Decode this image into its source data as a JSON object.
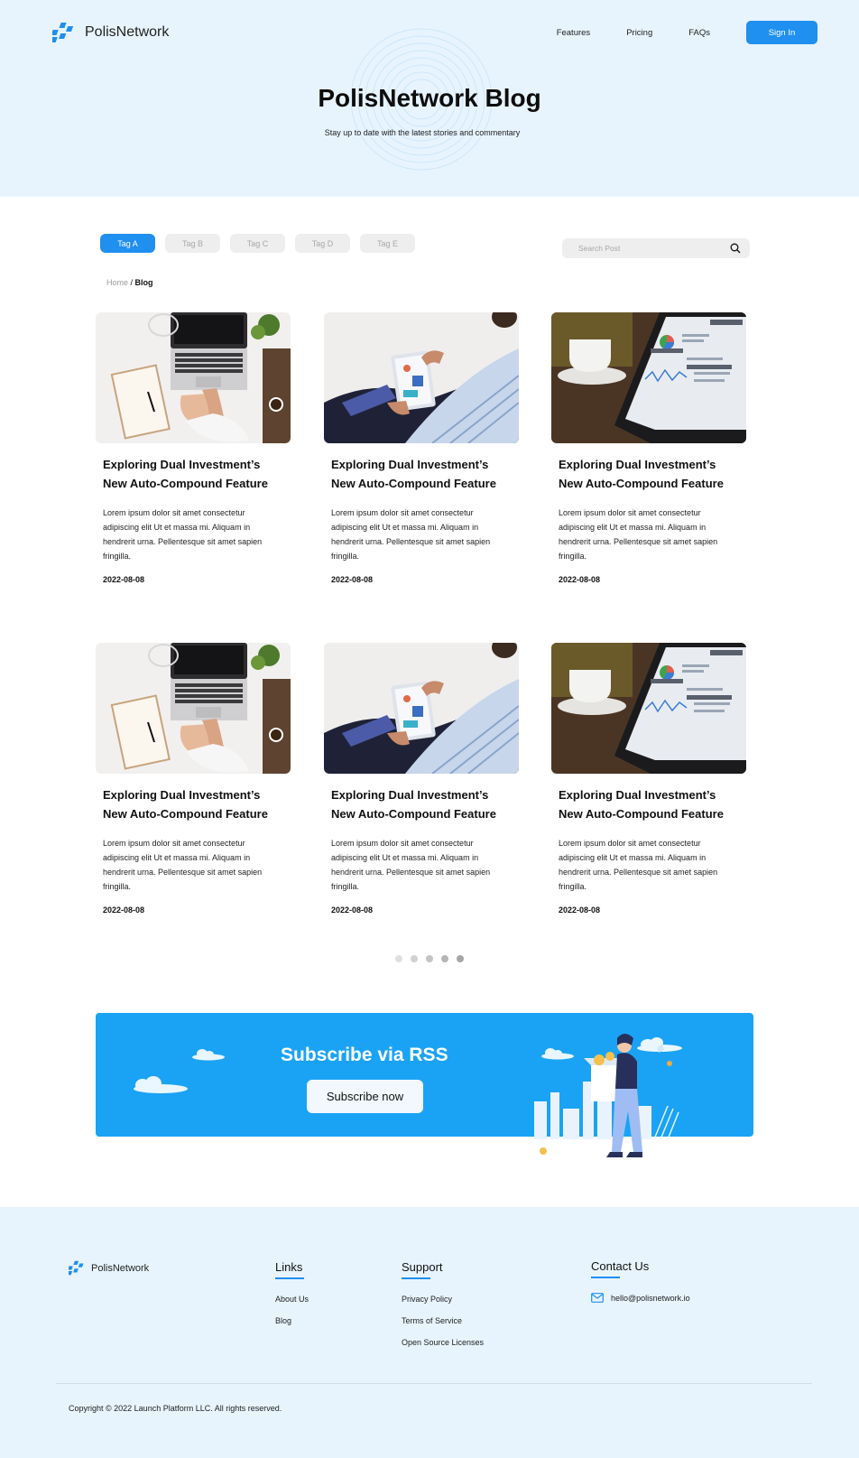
{
  "brand": {
    "name": "PolisNetwork",
    "accent": "#1f8ff0"
  },
  "nav": {
    "items": [
      "Features",
      "Pricing",
      "FAQs"
    ],
    "signin": "Sign In"
  },
  "hero": {
    "title": "PolisNetwork Blog",
    "subtitle": "Stay up to date with the latest stories and commentary"
  },
  "filters": {
    "tags": [
      "Tag A",
      "Tag B",
      "Tag C",
      "Tag D",
      "Tag E"
    ],
    "active": "Tag A"
  },
  "search": {
    "placeholder": "Search Post"
  },
  "breadcrumb": {
    "home": "Home",
    "separator": " / ",
    "current": "Blog"
  },
  "posts": [
    {
      "image": "laptop-desk-photo",
      "title": "Exploring Dual Investment’s New Auto-Compound Feature",
      "excerpt": "Lorem ipsum dolor sit amet consectetur adipiscing elit Ut et massa mi. Aliquam in hendrerit urna. Pellentesque sit amet sapien fringilla.",
      "date": "2022-08-08"
    },
    {
      "image": "tablet-charts-photo",
      "title": "Exploring Dual Investment’s New Auto-Compound Feature",
      "excerpt": "Lorem ipsum dolor sit amet consectetur adipiscing elit Ut et massa mi. Aliquam in hendrerit urna. Pellentesque sit amet sapien fringilla.",
      "date": "2022-08-08"
    },
    {
      "image": "analytics-tablet-photo",
      "title": "Exploring Dual Investment’s New Auto-Compound Feature",
      "excerpt": "Lorem ipsum dolor sit amet consectetur adipiscing elit Ut et massa mi. Aliquam in hendrerit urna. Pellentesque sit amet sapien fringilla.",
      "date": "2022-08-08"
    },
    {
      "image": "laptop-desk-photo",
      "title": "Exploring Dual Investment’s New Auto-Compound Feature",
      "excerpt": "Lorem ipsum dolor sit amet consectetur adipiscing elit Ut et massa mi. Aliquam in hendrerit urna. Pellentesque sit amet sapien fringilla.",
      "date": "2022-08-08"
    },
    {
      "image": "tablet-charts-photo",
      "title": "Exploring Dual Investment’s New Auto-Compound Feature",
      "excerpt": "Lorem ipsum dolor sit amet consectetur adipiscing elit Ut et massa mi. Aliquam in hendrerit urna. Pellentesque sit amet sapien fringilla.",
      "date": "2022-08-08"
    },
    {
      "image": "analytics-tablet-photo",
      "title": "Exploring Dual Investment’s New Auto-Compound Feature",
      "excerpt": "Lorem ipsum dolor sit amet consectetur adipiscing elit Ut et massa mi. Aliquam in hendrerit urna. Pellentesque sit amet sapien fringilla.",
      "date": "2022-08-08"
    }
  ],
  "pagination": {
    "pages": 5,
    "current": 5
  },
  "subscribe": {
    "title": "Subscribe via RSS",
    "button": "Subscribe now"
  },
  "footer": {
    "brand": "PolisNetwork",
    "links": {
      "heading": "Links",
      "items": [
        "About Us",
        "Blog"
      ]
    },
    "support": {
      "heading": "Support",
      "items": [
        "Privacy Policy",
        "Terms of Service",
        "Open Source Licenses"
      ]
    },
    "contact": {
      "heading": "Contact Us",
      "email": "hello@polisnetwork.io"
    },
    "copyright": "Copyright © 2022 Launch Platform LLC. All rights reserved."
  }
}
